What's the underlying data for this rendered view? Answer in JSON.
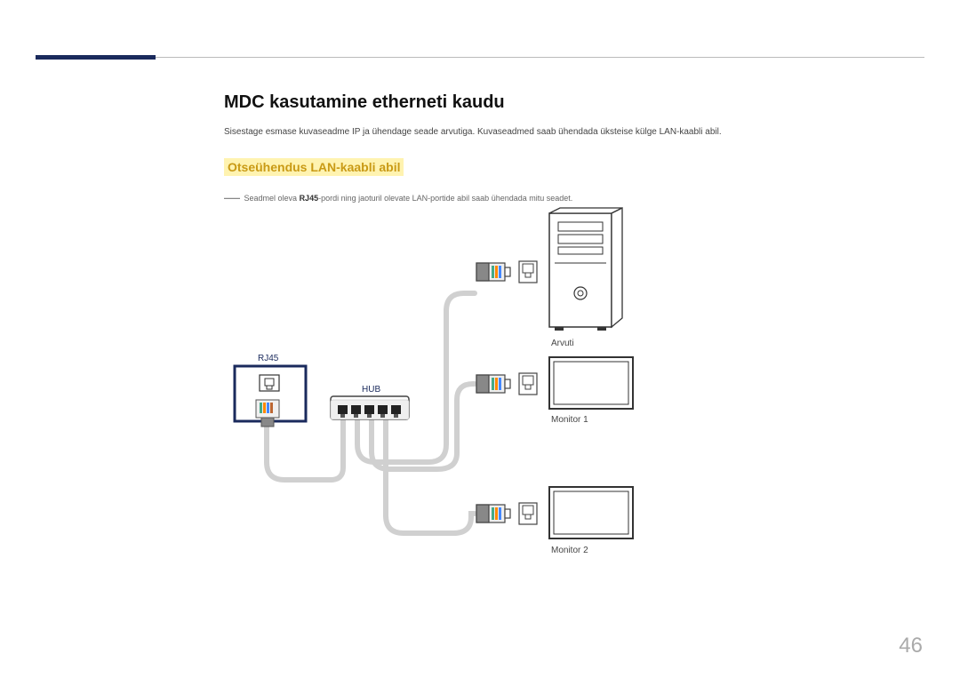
{
  "title": "MDC kasutamine etherneti kaudu",
  "intro": "Sisestage esmase kuvaseadme IP ja ühendage seade arvutiga. Kuvaseadmed saab ühendada üksteise külge LAN-kaabli abil.",
  "subhead": "Otseühendus LAN-kaabli abil",
  "note_prefix": "Seadmel oleva ",
  "note_bold": "RJ45",
  "note_suffix": "-pordi ning jaoturil olevate LAN-portide abil saab ühendada mitu seadet.",
  "labels": {
    "rj45": "RJ45",
    "hub": "HUB",
    "arvuti": "Arvuti",
    "monitor1": "Monitor 1",
    "monitor2": "Monitor 2"
  },
  "page_number": "46"
}
